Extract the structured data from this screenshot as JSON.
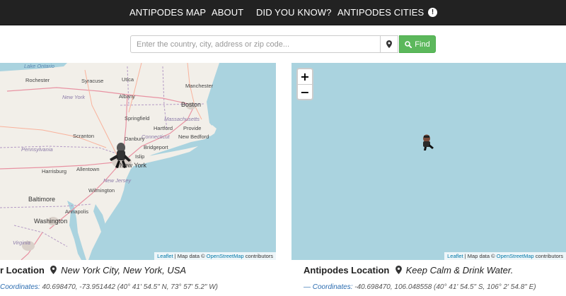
{
  "nav": {
    "items": [
      "ANTIPODES MAP",
      "ABOUT",
      "DID YOU KNOW?",
      "ANTIPODES CITIES"
    ],
    "help_icon": "exclamation-circle-icon"
  },
  "search": {
    "placeholder": "Enter the country, city, address or zip code...",
    "value": "",
    "locate_icon": "map-marker-icon",
    "find_label": "Find",
    "find_icon": "search-icon",
    "find_color": "#5cb85c"
  },
  "left_map": {
    "labels": {
      "lake_ontario": "Lake Ontario",
      "rochester": "Rochester",
      "syracuse": "Syracuse",
      "utica": "Utica",
      "new_york_state": "New York",
      "albany": "Albany",
      "manchester": "Manchester",
      "boston": "Boston",
      "springfield": "Springfield",
      "massachusetts": "Massachusetts",
      "hartford": "Hartford",
      "connecticut": "Connecticut",
      "providence": "Provide",
      "new_bedford": "New Bedford",
      "scranton": "Scranton",
      "danbury": "Danbury",
      "bridgeport": "Bridgeport",
      "pennsylvania": "Pennsylvania",
      "islip": "Islip",
      "harrisburg": "Harrisburg",
      "allentown": "Allentown",
      "new_york_city": "New York",
      "new_jersey": "New Jersey",
      "wilmington": "Wilmington",
      "baltimore": "Baltimore",
      "annapolis": "Annapolis",
      "washington": "Washington",
      "virginia": "Virginia"
    },
    "attribution": {
      "leaflet": "Leaflet",
      "text": " | Map data © ",
      "osm": "OpenStreetMap",
      "suffix": " contributors"
    }
  },
  "right_map": {
    "zoom_in": "+",
    "zoom_out": "−",
    "attribution": {
      "leaflet": "Leaflet",
      "text": " | Map data © ",
      "osm": "OpenStreetMap",
      "suffix": " contributors"
    }
  },
  "your_location": {
    "title": "r Location",
    "icon": "map-marker-icon",
    "place": "New York City, New York, USA",
    "coords_label": "Coordinates:",
    "coords_value": " 40.698470, -73.951442 (40° 41' 54.5\" N, 73° 57' 5.2\" W)"
  },
  "antipodes_location": {
    "title": "Antipodes Location",
    "icon": "map-marker-icon",
    "place": "Keep Calm & Drink Water.",
    "coords_label": "— Coordinates:",
    "coords_value": " -40.698470, 106.048558 (40° 41' 54.5\" S, 106° 2' 54.8\" E)"
  }
}
